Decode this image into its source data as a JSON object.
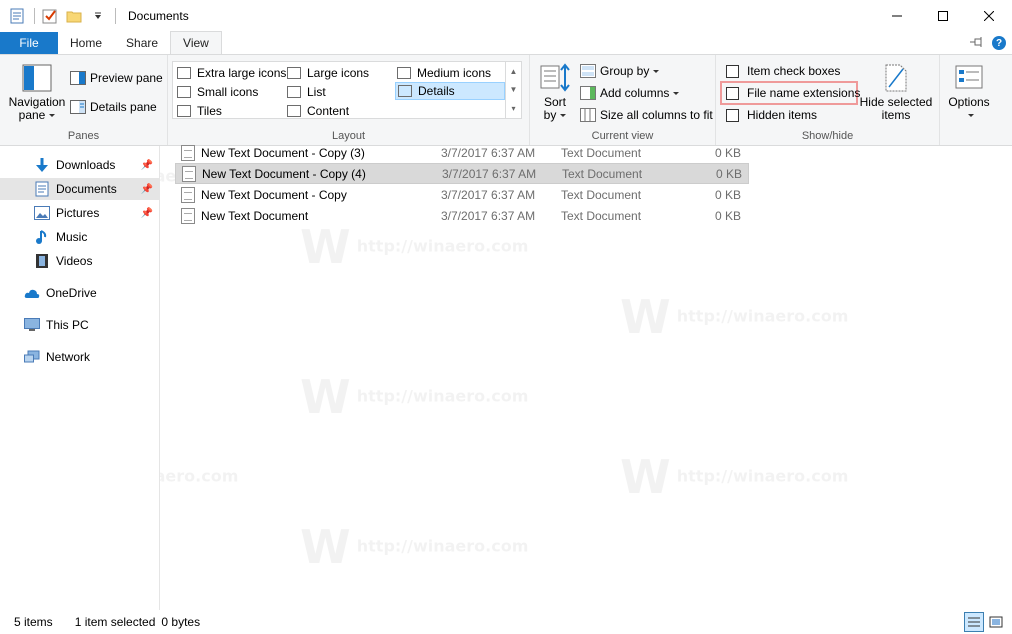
{
  "window": {
    "title": "Documents",
    "minimize_icon": "minimize-icon",
    "maximize_icon": "maximize-icon",
    "close_icon": "close-icon"
  },
  "tabs": [
    {
      "label": "File"
    },
    {
      "label": "Home"
    },
    {
      "label": "Share"
    },
    {
      "label": "View"
    }
  ],
  "ribbon": {
    "panes": {
      "navigation_pane_line1": "Navigation",
      "navigation_pane_line2": "pane",
      "preview_pane": "Preview pane",
      "details_pane": "Details pane",
      "caption": "Panes"
    },
    "layout": {
      "items": [
        "Extra large icons",
        "Large icons",
        "Medium icons",
        "Small icons",
        "List",
        "Details",
        "Tiles",
        "Content"
      ],
      "selected": "Details",
      "caption": "Layout"
    },
    "current_view": {
      "sort_line1": "Sort",
      "sort_line2": "by",
      "group_by": "Group by",
      "add_columns": "Add columns",
      "size_columns": "Size all columns to fit",
      "caption": "Current view"
    },
    "show_hide": {
      "item_check_boxes": "Item check boxes",
      "file_name_extensions": "File name extensions",
      "hidden_items": "Hidden items",
      "hide_selected_line1": "Hide selected",
      "hide_selected_line2": "items",
      "caption": "Show/hide"
    },
    "options": "Options"
  },
  "nav": [
    {
      "label": "Downloads",
      "icon": "download-icon",
      "pinned": true
    },
    {
      "label": "Documents",
      "icon": "documents-icon",
      "pinned": true,
      "selected": true
    },
    {
      "label": "Pictures",
      "icon": "pictures-icon",
      "pinned": true
    },
    {
      "label": "Music",
      "icon": "music-icon"
    },
    {
      "label": "Videos",
      "icon": "videos-icon"
    },
    {
      "label": "OneDrive",
      "icon": "onedrive-icon"
    },
    {
      "label": "This PC",
      "icon": "this-pc-icon"
    },
    {
      "label": "Network",
      "icon": "network-icon"
    }
  ],
  "files": [
    {
      "name": "New Text Document - Copy (3)",
      "date": "3/7/2017 6:37 AM",
      "type": "Text Document",
      "size": "0 KB"
    },
    {
      "name": "New Text Document - Copy (4)",
      "date": "3/7/2017 6:37 AM",
      "type": "Text Document",
      "size": "0 KB",
      "selected": true
    },
    {
      "name": "New Text Document - Copy",
      "date": "3/7/2017 6:37 AM",
      "type": "Text Document",
      "size": "0 KB"
    },
    {
      "name": "New Text Document",
      "date": "3/7/2017 6:37 AM",
      "type": "Text Document",
      "size": "0 KB"
    }
  ],
  "status": {
    "items": "5 items",
    "selected": "1 item selected",
    "size": "0 bytes"
  },
  "watermark": "http://winaero.com",
  "watermark_logo": "W",
  "colors": {
    "accent": "#1979ca",
    "selected_row": "#d9d9d9",
    "highlight_box": "#ef9a9a"
  }
}
